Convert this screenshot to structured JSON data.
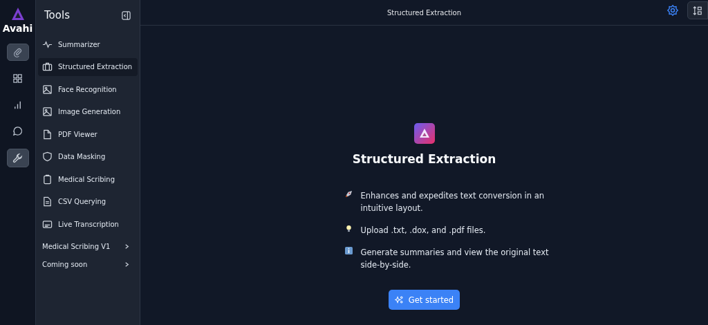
{
  "brand": {
    "name": "Avahi"
  },
  "rail": [
    {
      "kind": "paperclip",
      "selected": true
    },
    {
      "kind": "grid",
      "selected": false
    },
    {
      "kind": "bar-chart",
      "selected": false
    },
    {
      "kind": "chat",
      "selected": false
    },
    {
      "kind": "wrench",
      "selected": true
    }
  ],
  "tools": {
    "title": "Tools",
    "items": [
      {
        "label": "Summarizer",
        "kind": "pulse",
        "selected": false
      },
      {
        "label": "Structured Extraction",
        "kind": "briefcase",
        "selected": true
      },
      {
        "label": "Face Recognition",
        "kind": "image",
        "selected": false
      },
      {
        "label": "Image Generation",
        "kind": "image",
        "selected": false
      },
      {
        "label": "PDF Viewer",
        "kind": "file",
        "selected": false
      },
      {
        "label": "Data Masking",
        "kind": "shield",
        "selected": false
      },
      {
        "label": "Medical Scribing",
        "kind": "clipboard",
        "selected": false
      },
      {
        "label": "CSV Querying",
        "kind": "document",
        "selected": false
      },
      {
        "label": "Live Transcription",
        "kind": "caption",
        "selected": false
      }
    ],
    "groups": [
      {
        "label": "Medical Scribing V1",
        "expanded": false
      },
      {
        "label": "Coming soon",
        "expanded": false
      }
    ]
  },
  "header": {
    "title": "Structured Extraction"
  },
  "main": {
    "title": "Structured Extraction",
    "features": [
      {
        "kind": "rocket",
        "text": "Enhances and expedites text conversion in an intuitive layout."
      },
      {
        "kind": "bulb",
        "text": "Upload .txt, .dox, and .pdf files."
      },
      {
        "kind": "info",
        "text": "Generate summaries and view the original text side-by-side."
      }
    ],
    "button": "Get started"
  }
}
